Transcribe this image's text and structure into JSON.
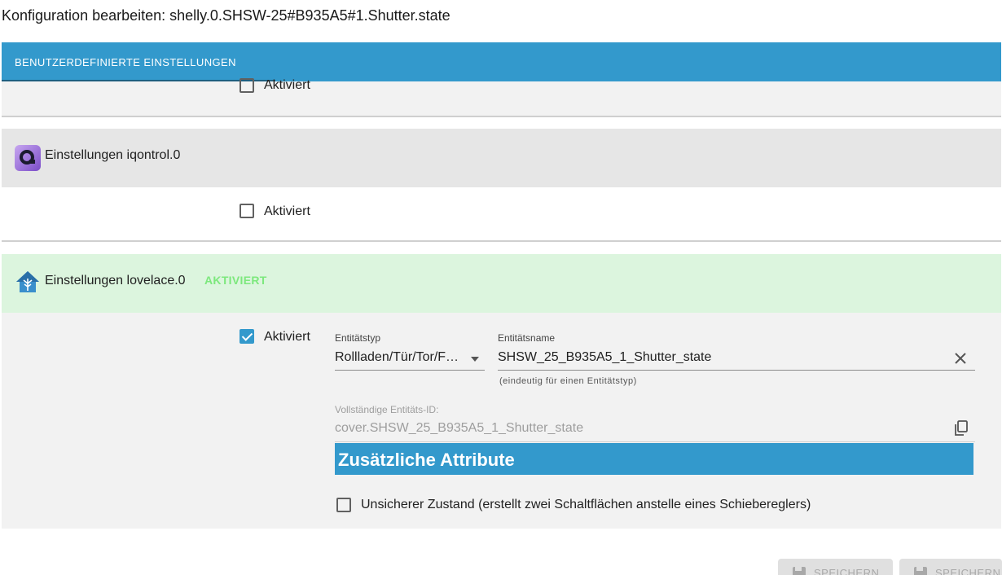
{
  "page": {
    "title": "Konfiguration bearbeiten: shelly.0.SHSW-25#B935A5#1.Shutter.state"
  },
  "tabs": [
    {
      "label": "BENUTZERDEFINIERTE EINSTELLUNGEN",
      "active": true
    }
  ],
  "sections": {
    "top_partial": {
      "enabled_label": "Aktiviert",
      "checked": false
    },
    "iqontrol": {
      "title": "Einstellungen iqontrol.0",
      "enabled_label": "Aktiviert",
      "checked": false,
      "icon": "iqontrol-icon"
    },
    "lovelace": {
      "title": "Einstellungen lovelace.0",
      "badge": "AKTIVIERT",
      "enabled_label": "Aktiviert",
      "checked": true,
      "icon": "lovelace-house-icon",
      "entity_type": {
        "label": "Entitätstyp",
        "value": "Rollladen/Tür/Tor/F…"
      },
      "entity_name": {
        "label": "Entitätsname",
        "value": "SHSW_25_B935A5_1_Shutter_state",
        "helper": "(eindeutig für einen Entitätstyp)"
      },
      "full_id": {
        "label": "Vollständige Entitäts-ID:",
        "value": "cover.SHSW_25_B935A5_1_Shutter_state"
      },
      "attributes_header": "Zusätzliche Attribute",
      "unsafe_state": {
        "label": "Unsicherer Zustand (erstellt zwei Schaltflächen anstelle eines Schiebereglers)",
        "checked": false
      }
    }
  },
  "footer": {
    "save_label": "SPEICHERN",
    "save_close_label": "SPEICHERN"
  },
  "colors": {
    "accent": "#3399cc",
    "activated_badge": "#7de87d",
    "active_section_bg": "#dcf5de"
  }
}
